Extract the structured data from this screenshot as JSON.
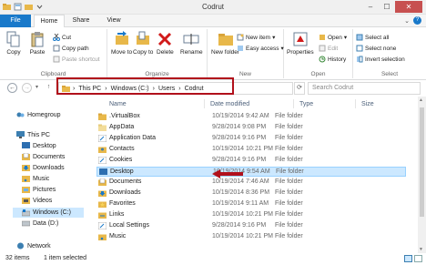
{
  "window": {
    "title": "Codrut",
    "minimize": "–",
    "maximize": "☐",
    "close": "✕"
  },
  "tabs": {
    "file": "File",
    "home": "Home",
    "share": "Share",
    "view": "View",
    "help": "?",
    "expand": "⌄"
  },
  "ribbon": {
    "clipboard": {
      "label": "Clipboard",
      "copy": "Copy",
      "paste": "Paste",
      "cut": "Cut",
      "copy_path": "Copy path",
      "paste_shortcut": "Paste shortcut"
    },
    "organize": {
      "label": "Organize",
      "move_to": "Move to",
      "copy_to": "Copy to",
      "delete": "Delete",
      "rename": "Rename"
    },
    "new": {
      "label": "New",
      "new_folder": "New folder",
      "new_item": "New item",
      "easy_access": "Easy access"
    },
    "open": {
      "label": "Open",
      "properties": "Properties",
      "open": "Open",
      "edit": "Edit",
      "history": "History"
    },
    "select": {
      "label": "Select",
      "select_all": "Select all",
      "select_none": "Select none",
      "invert_selection": "Invert selection"
    }
  },
  "address": {
    "crumbs": [
      "This PC",
      "Windows (C:)",
      "Users",
      "Codrut"
    ],
    "search_placeholder": "Search Codrut",
    "back": "←",
    "forward": "→",
    "up": "↑",
    "refresh": "⟳"
  },
  "nav_pane": {
    "items": [
      {
        "label": "Homegroup"
      },
      {
        "label": "This PC"
      },
      {
        "label": "Desktop"
      },
      {
        "label": "Documents"
      },
      {
        "label": "Downloads"
      },
      {
        "label": "Music"
      },
      {
        "label": "Pictures"
      },
      {
        "label": "Videos"
      },
      {
        "label": "Windows (C:)"
      },
      {
        "label": "Data (D:)"
      },
      {
        "label": "Network"
      }
    ]
  },
  "columns": {
    "name": "Name",
    "date_modified": "Date modified",
    "type": "Type",
    "size": "Size"
  },
  "files": [
    {
      "name": ".VirtualBox",
      "date": "10/19/2014 9:42 AM",
      "type": "File folder"
    },
    {
      "name": "AppData",
      "date": "9/28/2014 9:08 PM",
      "type": "File folder"
    },
    {
      "name": "Application Data",
      "date": "9/28/2014 9:16 PM",
      "type": "File folder"
    },
    {
      "name": "Contacts",
      "date": "10/19/2014 10:21 PM",
      "type": "File folder"
    },
    {
      "name": "Cookies",
      "date": "9/28/2014 9:16 PM",
      "type": "File folder"
    },
    {
      "name": "Desktop",
      "date": "10/19/2014 9:54 AM",
      "type": "File folder"
    },
    {
      "name": "Documents",
      "date": "10/19/2014 7:46 AM",
      "type": "File folder"
    },
    {
      "name": "Downloads",
      "date": "10/19/2014 8:36 PM",
      "type": "File folder"
    },
    {
      "name": "Favorites",
      "date": "10/19/2014 9:11 AM",
      "type": "File folder"
    },
    {
      "name": "Links",
      "date": "10/19/2014 10:21 PM",
      "type": "File folder"
    },
    {
      "name": "Local Settings",
      "date": "9/28/2014 9:16 PM",
      "type": "File folder"
    },
    {
      "name": "Music",
      "date": "10/19/2014 10:21 PM",
      "type": "File folder"
    }
  ],
  "status": {
    "items": "32 items",
    "selected": "1 item selected"
  },
  "colors": {
    "accent": "#1979ca",
    "selection": "#cce8ff",
    "highlight_red": "#b1101b"
  }
}
